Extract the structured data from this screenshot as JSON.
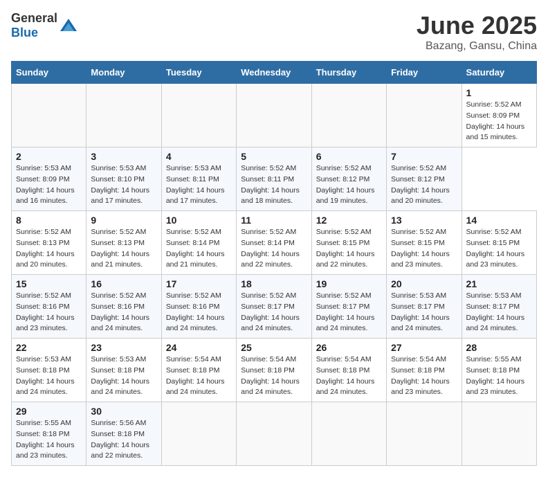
{
  "header": {
    "logo_general": "General",
    "logo_blue": "Blue",
    "title": "June 2025",
    "subtitle": "Bazang, Gansu, China"
  },
  "calendar": {
    "days_of_week": [
      "Sunday",
      "Monday",
      "Tuesday",
      "Wednesday",
      "Thursday",
      "Friday",
      "Saturday"
    ],
    "weeks": [
      [
        {
          "day": "",
          "empty": true
        },
        {
          "day": "",
          "empty": true
        },
        {
          "day": "",
          "empty": true
        },
        {
          "day": "",
          "empty": true
        },
        {
          "day": "",
          "empty": true
        },
        {
          "day": "",
          "empty": true
        },
        {
          "day": "1",
          "sunrise": "Sunrise: 5:52 AM",
          "sunset": "Sunset: 8:09 PM",
          "daylight": "Daylight: 14 hours and 15 minutes."
        }
      ],
      [
        {
          "day": "2",
          "sunrise": "Sunrise: 5:53 AM",
          "sunset": "Sunset: 8:09 PM",
          "daylight": "Daylight: 14 hours and 16 minutes."
        },
        {
          "day": "3",
          "sunrise": "Sunrise: 5:53 AM",
          "sunset": "Sunset: 8:10 PM",
          "daylight": "Daylight: 14 hours and 17 minutes."
        },
        {
          "day": "4",
          "sunrise": "Sunrise: 5:53 AM",
          "sunset": "Sunset: 8:11 PM",
          "daylight": "Daylight: 14 hours and 17 minutes."
        },
        {
          "day": "5",
          "sunrise": "Sunrise: 5:52 AM",
          "sunset": "Sunset: 8:11 PM",
          "daylight": "Daylight: 14 hours and 18 minutes."
        },
        {
          "day": "6",
          "sunrise": "Sunrise: 5:52 AM",
          "sunset": "Sunset: 8:12 PM",
          "daylight": "Daylight: 14 hours and 19 minutes."
        },
        {
          "day": "7",
          "sunrise": "Sunrise: 5:52 AM",
          "sunset": "Sunset: 8:12 PM",
          "daylight": "Daylight: 14 hours and 20 minutes."
        }
      ],
      [
        {
          "day": "8",
          "sunrise": "Sunrise: 5:52 AM",
          "sunset": "Sunset: 8:13 PM",
          "daylight": "Daylight: 14 hours and 20 minutes."
        },
        {
          "day": "9",
          "sunrise": "Sunrise: 5:52 AM",
          "sunset": "Sunset: 8:13 PM",
          "daylight": "Daylight: 14 hours and 21 minutes."
        },
        {
          "day": "10",
          "sunrise": "Sunrise: 5:52 AM",
          "sunset": "Sunset: 8:14 PM",
          "daylight": "Daylight: 14 hours and 21 minutes."
        },
        {
          "day": "11",
          "sunrise": "Sunrise: 5:52 AM",
          "sunset": "Sunset: 8:14 PM",
          "daylight": "Daylight: 14 hours and 22 minutes."
        },
        {
          "day": "12",
          "sunrise": "Sunrise: 5:52 AM",
          "sunset": "Sunset: 8:15 PM",
          "daylight": "Daylight: 14 hours and 22 minutes."
        },
        {
          "day": "13",
          "sunrise": "Sunrise: 5:52 AM",
          "sunset": "Sunset: 8:15 PM",
          "daylight": "Daylight: 14 hours and 23 minutes."
        },
        {
          "day": "14",
          "sunrise": "Sunrise: 5:52 AM",
          "sunset": "Sunset: 8:15 PM",
          "daylight": "Daylight: 14 hours and 23 minutes."
        }
      ],
      [
        {
          "day": "15",
          "sunrise": "Sunrise: 5:52 AM",
          "sunset": "Sunset: 8:16 PM",
          "daylight": "Daylight: 14 hours and 23 minutes."
        },
        {
          "day": "16",
          "sunrise": "Sunrise: 5:52 AM",
          "sunset": "Sunset: 8:16 PM",
          "daylight": "Daylight: 14 hours and 24 minutes."
        },
        {
          "day": "17",
          "sunrise": "Sunrise: 5:52 AM",
          "sunset": "Sunset: 8:16 PM",
          "daylight": "Daylight: 14 hours and 24 minutes."
        },
        {
          "day": "18",
          "sunrise": "Sunrise: 5:52 AM",
          "sunset": "Sunset: 8:17 PM",
          "daylight": "Daylight: 14 hours and 24 minutes."
        },
        {
          "day": "19",
          "sunrise": "Sunrise: 5:52 AM",
          "sunset": "Sunset: 8:17 PM",
          "daylight": "Daylight: 14 hours and 24 minutes."
        },
        {
          "day": "20",
          "sunrise": "Sunrise: 5:53 AM",
          "sunset": "Sunset: 8:17 PM",
          "daylight": "Daylight: 14 hours and 24 minutes."
        },
        {
          "day": "21",
          "sunrise": "Sunrise: 5:53 AM",
          "sunset": "Sunset: 8:17 PM",
          "daylight": "Daylight: 14 hours and 24 minutes."
        }
      ],
      [
        {
          "day": "22",
          "sunrise": "Sunrise: 5:53 AM",
          "sunset": "Sunset: 8:18 PM",
          "daylight": "Daylight: 14 hours and 24 minutes."
        },
        {
          "day": "23",
          "sunrise": "Sunrise: 5:53 AM",
          "sunset": "Sunset: 8:18 PM",
          "daylight": "Daylight: 14 hours and 24 minutes."
        },
        {
          "day": "24",
          "sunrise": "Sunrise: 5:54 AM",
          "sunset": "Sunset: 8:18 PM",
          "daylight": "Daylight: 14 hours and 24 minutes."
        },
        {
          "day": "25",
          "sunrise": "Sunrise: 5:54 AM",
          "sunset": "Sunset: 8:18 PM",
          "daylight": "Daylight: 14 hours and 24 minutes."
        },
        {
          "day": "26",
          "sunrise": "Sunrise: 5:54 AM",
          "sunset": "Sunset: 8:18 PM",
          "daylight": "Daylight: 14 hours and 24 minutes."
        },
        {
          "day": "27",
          "sunrise": "Sunrise: 5:54 AM",
          "sunset": "Sunset: 8:18 PM",
          "daylight": "Daylight: 14 hours and 23 minutes."
        },
        {
          "day": "28",
          "sunrise": "Sunrise: 5:55 AM",
          "sunset": "Sunset: 8:18 PM",
          "daylight": "Daylight: 14 hours and 23 minutes."
        }
      ],
      [
        {
          "day": "29",
          "sunrise": "Sunrise: 5:55 AM",
          "sunset": "Sunset: 8:18 PM",
          "daylight": "Daylight: 14 hours and 23 minutes."
        },
        {
          "day": "30",
          "sunrise": "Sunrise: 5:56 AM",
          "sunset": "Sunset: 8:18 PM",
          "daylight": "Daylight: 14 hours and 22 minutes."
        },
        {
          "day": "",
          "empty": true
        },
        {
          "day": "",
          "empty": true
        },
        {
          "day": "",
          "empty": true
        },
        {
          "day": "",
          "empty": true
        },
        {
          "day": "",
          "empty": true
        }
      ]
    ]
  }
}
